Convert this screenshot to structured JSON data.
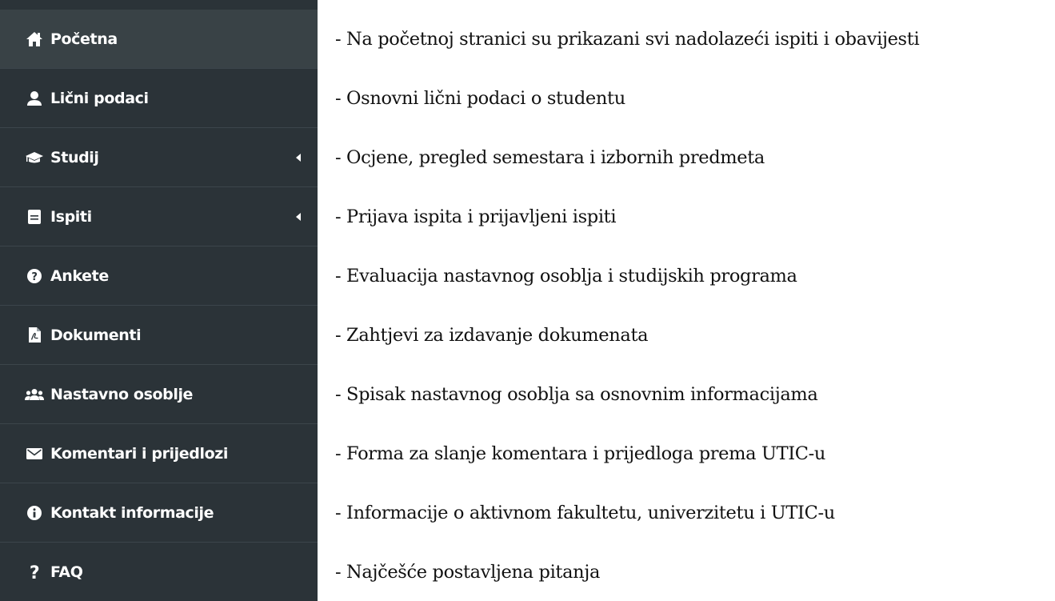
{
  "sidebar": {
    "items": [
      {
        "label": "Početna",
        "icon": "home-icon",
        "description": "- Na početnoj stranici su prikazani svi nadolazeći ispiti i obavijesti"
      },
      {
        "label": "Lični podaci",
        "icon": "user-icon",
        "description": "- Osnovni lični podaci o studentu"
      },
      {
        "label": "Studij",
        "icon": "graduation-cap-icon",
        "description": "- Ocjene, pregled semestara i izbornih predmeta"
      },
      {
        "label": "Ispiti",
        "icon": "book-icon",
        "description": "- Prijava ispita i prijavljeni ispiti"
      },
      {
        "label": "Ankete",
        "icon": "question-circle-icon",
        "description": "- Evaluacija nastavnog osoblja i studijskih programa"
      },
      {
        "label": "Dokumenti",
        "icon": "pdf-file-icon",
        "description": "- Zahtjevi za izdavanje dokumenata"
      },
      {
        "label": "Nastavno osoblje",
        "icon": "users-icon",
        "description": "- Spisak nastavnog osoblja sa osnovnim informacijama"
      },
      {
        "label": "Komentari i prijedlozi",
        "icon": "envelope-icon",
        "description": "- Forma za slanje komentara i prijedloga prema UTIC-u"
      },
      {
        "label": "Kontakt informacije",
        "icon": "info-circle-icon",
        "description": "- Informacije o aktivnom fakultetu, univerzitetu i UTIC-u"
      },
      {
        "label": "FAQ",
        "icon": "question-mark-icon",
        "description": "- Najčešće postavljena pitanja"
      }
    ]
  },
  "colors": {
    "sidebar_background": "#2b3338",
    "active_item_background": "#394246",
    "item_text": "#ffffff",
    "description_text": "#111111"
  }
}
